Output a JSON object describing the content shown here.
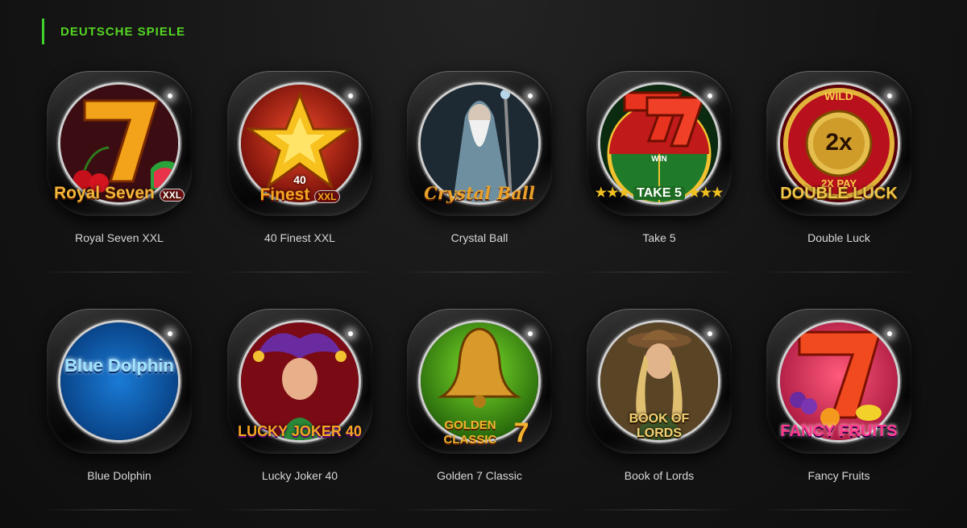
{
  "section": {
    "title": "DEUTSCHE SPIELE"
  },
  "games": [
    {
      "name": "Royal Seven XXL",
      "logo": "Royal Seven",
      "badge": "XXL",
      "icon": "seven-icon"
    },
    {
      "name": "40 Finest XXL",
      "logo": "Finest",
      "badge": "XXL",
      "prefix": "40",
      "icon": "star-icon"
    },
    {
      "name": "Crystal Ball",
      "logo": "Crystal Ball",
      "icon": "wizard-icon"
    },
    {
      "name": "Take 5",
      "logo": "TAKE 5",
      "wheel": "WIN",
      "icon": "wheel-icon"
    },
    {
      "name": "Double Luck",
      "logo": "DOUBLE LUCK",
      "wild": "WILD",
      "mult": "2x",
      "pay": "2X PAY",
      "icon": "coin-icon"
    },
    {
      "name": "Blue Dolphin",
      "logo": "Blue Dolphin",
      "icon": "water-icon"
    },
    {
      "name": "Lucky Joker 40",
      "logo": "LUCKY JOKER 40",
      "icon": "joker-icon"
    },
    {
      "name": "Golden 7 Classic",
      "logo": "GOLDEN CLASSIC",
      "seven": "7",
      "icon": "bell-icon"
    },
    {
      "name": "Book of Lords",
      "logo": "BOOK OF LORDS",
      "icon": "adventurer-icon"
    },
    {
      "name": "Fancy Fruits",
      "logo": "FANCY FRUITS",
      "seven": "7",
      "icon": "fruit-icon"
    }
  ],
  "colors": {
    "accent": "#55d623",
    "label": "#d8d8d8"
  }
}
